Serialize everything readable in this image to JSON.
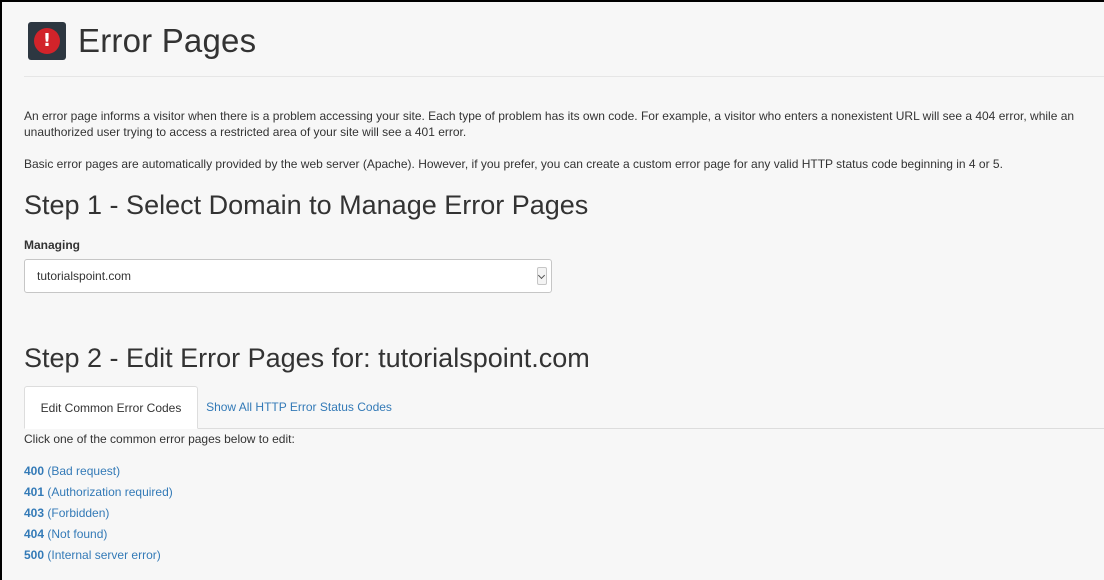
{
  "header": {
    "title": "Error Pages",
    "icon": "error-exclamation-icon",
    "icon_color": "#d2232a"
  },
  "intro": {
    "paragraph1": "An error page informs a visitor when there is a problem accessing your site. Each type of problem has its own code. For example, a visitor who enters a nonexistent URL will see a 404 error, while an unauthorized user trying to access a restricted area of your site will see a 401 error.",
    "paragraph2": "Basic error pages are automatically provided by the web server (Apache). However, if you prefer, you can create a custom error page for any valid HTTP status code beginning in 4 or 5."
  },
  "step1": {
    "heading": "Step 1 - Select Domain to Manage Error Pages",
    "label": "Managing",
    "selected_domain": "tutorialspoint.com"
  },
  "step2": {
    "heading": "Step 2 - Edit Error Pages for: tutorialspoint.com",
    "tabs": [
      {
        "label": "Edit Common Error Codes",
        "active": true
      },
      {
        "label": "Show All HTTP Error Status Codes",
        "active": false
      }
    ],
    "instruction": "Click one of the common error pages below to edit:",
    "codes": [
      {
        "code": "400",
        "desc": "(Bad request)"
      },
      {
        "code": "401",
        "desc": "(Authorization required)"
      },
      {
        "code": "403",
        "desc": "(Forbidden)"
      },
      {
        "code": "404",
        "desc": "(Not found)"
      },
      {
        "code": "500",
        "desc": "(Internal server error)"
      }
    ]
  },
  "colors": {
    "link": "#337ab7",
    "text": "#333333",
    "background": "#f7f7f7"
  }
}
